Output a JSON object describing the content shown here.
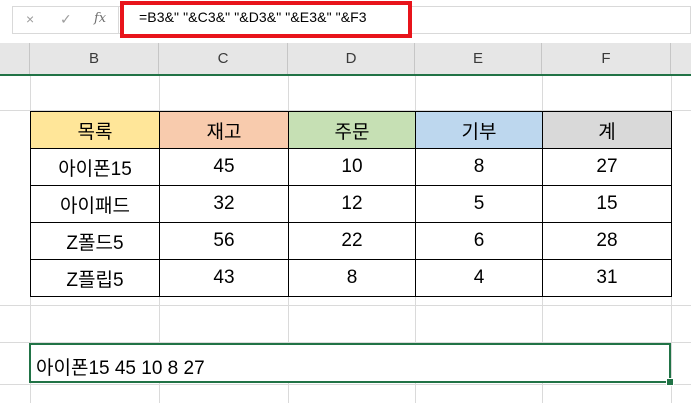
{
  "formula_bar": {
    "cancel_icon": "×",
    "enter_icon": "✓",
    "fx_label": "fx",
    "formula": "=B3&\" \"&C3&\" \"&D3&\" \"&E3&\" \"&F3",
    "highlight_color": "#e8141b"
  },
  "columns": [
    "B",
    "C",
    "D",
    "E",
    "F"
  ],
  "table": {
    "headers": [
      "목록",
      "재고",
      "주문",
      "기부",
      "계"
    ],
    "header_colors": [
      "#ffe699",
      "#f8cbad",
      "#c6e0b4",
      "#bdd7ee",
      "#d9d9d9"
    ],
    "rows": [
      [
        "아이폰15",
        "45",
        "10",
        "8",
        "27"
      ],
      [
        "아이패드",
        "32",
        "12",
        "5",
        "15"
      ],
      [
        "Z폴드5",
        "56",
        "22",
        "6",
        "28"
      ],
      [
        "Z플립5",
        "43",
        "8",
        "4",
        "31"
      ]
    ]
  },
  "result_cell": {
    "value": "아이폰15 45 10 8 27"
  },
  "accent_color": "#217346"
}
